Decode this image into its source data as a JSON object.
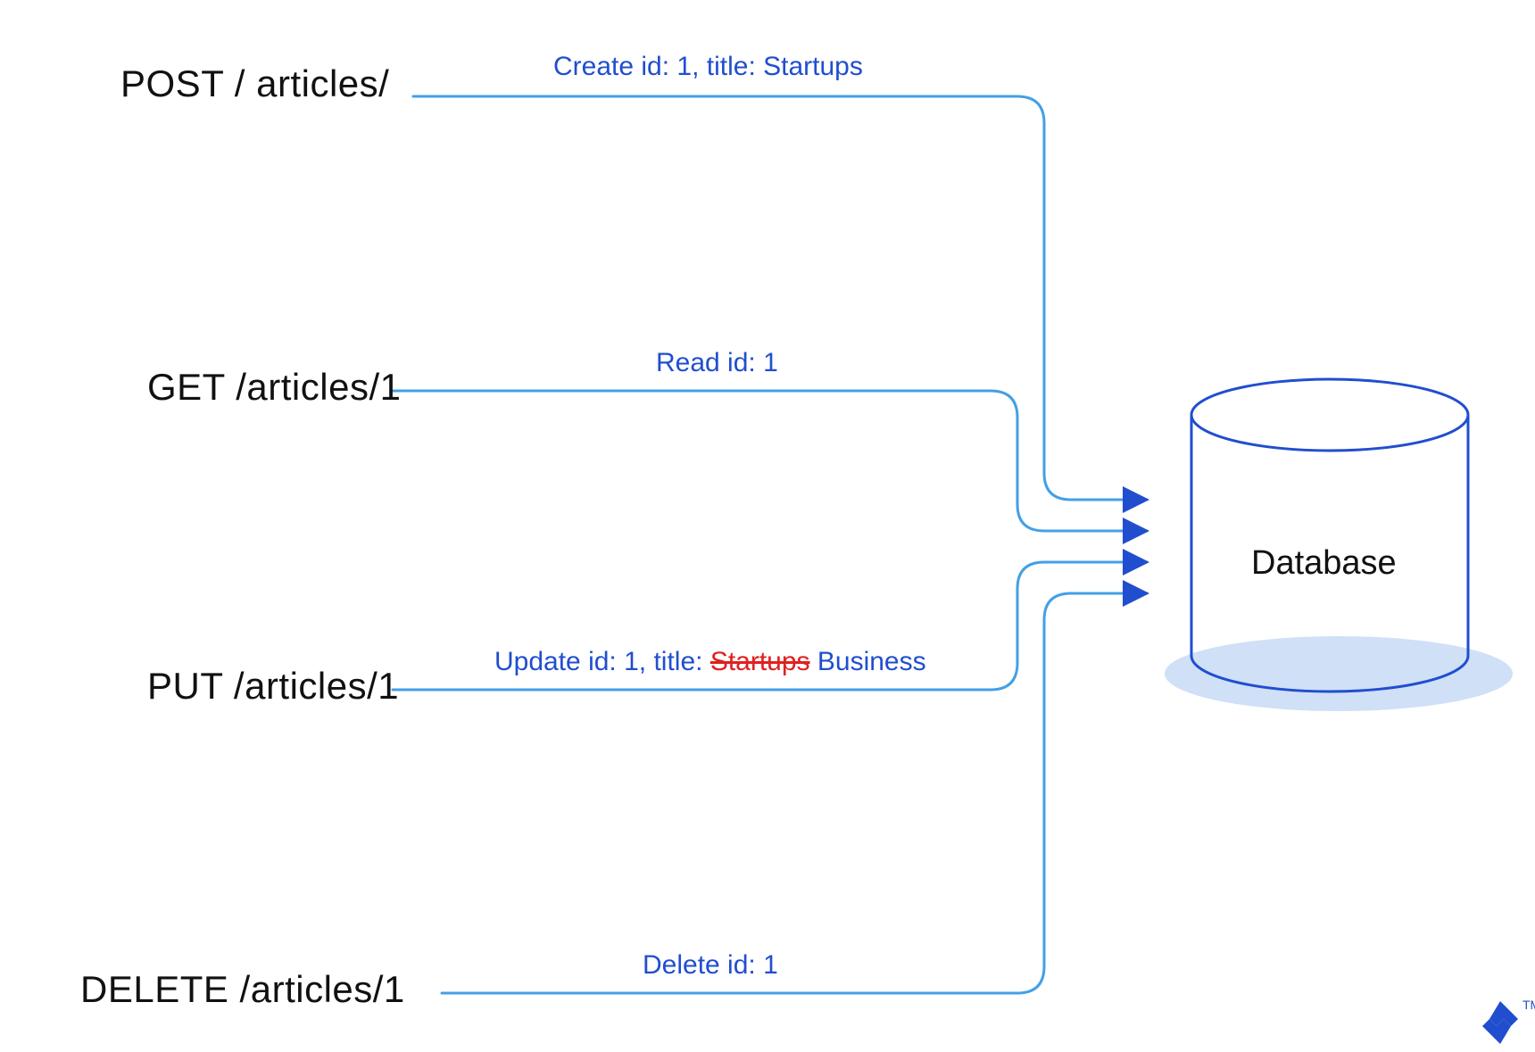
{
  "methods": {
    "post": "POST / articles/",
    "get": "GET /articles/1",
    "put": "PUT /articles/1",
    "delete": "DELETE /articles/1"
  },
  "descriptions": {
    "post": "Create id: 1, title: Startups",
    "get": "Read id: 1",
    "put_prefix": "Update id: 1, title: ",
    "put_strike": "Startups",
    "put_suffix": " Business",
    "delete": "Delete id: 1"
  },
  "database_label": "Database",
  "trademark": "TM",
  "colors": {
    "arrow": "#43a0e6",
    "db_outline": "#204ecf",
    "db_shadow": "#cfe0f7",
    "text_blue": "#204ecf",
    "strike_red": "#e02020"
  }
}
